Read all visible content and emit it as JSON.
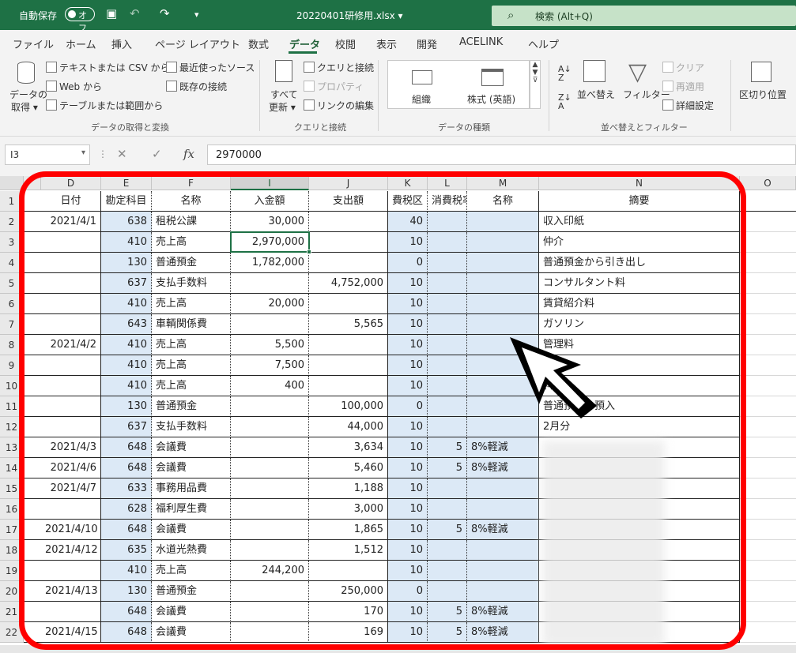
{
  "titlebar": {
    "autosave_label": "自動保存",
    "autosave_state": "オフ",
    "doc_title": "20220401研修用.xlsx",
    "search_placeholder": "検索 (Alt+Q)"
  },
  "menu": [
    "ファイル",
    "ホーム",
    "挿入",
    "ページ レイアウト",
    "数式",
    "データ",
    "校閲",
    "表示",
    "開発",
    "ACELINK",
    "ヘルプ"
  ],
  "menu_active": "データ",
  "ribbon": {
    "get_data": [
      "データの",
      "取得"
    ],
    "text_csv": "テキストまたは CSV から",
    "from_web": "Web から",
    "from_table": "テーブルまたは範囲から",
    "recent_sources": "最近使ったソース",
    "existing_conn": "既存の接続",
    "group_get": "データの取得と変換",
    "refresh_all": [
      "すべて",
      "更新"
    ],
    "queries_conn": "クエリと接続",
    "properties": "プロパティ",
    "edit_links": "リンクの編集",
    "group_queries": "クエリと接続",
    "type_org": "組織",
    "type_stock": "株式 (英語)",
    "group_types": "データの種類",
    "sort": "並べ替え",
    "filter": "フィルター",
    "clear": "クリア",
    "reapply": "再適用",
    "advanced": "詳細設定",
    "group_sort": "並べ替えとフィルター",
    "text_to_columns": "区切り位置"
  },
  "formula_bar": {
    "name_box": "I3",
    "value": "2970000"
  },
  "columns": [
    "D",
    "E",
    "F",
    "I",
    "J",
    "K",
    "L",
    "M",
    "N",
    "O"
  ],
  "selected_column": "I",
  "header_row": [
    "日付",
    "勘定科目",
    "名称",
    "入金額",
    "支出額",
    "費税区",
    "消費税率",
    "名称",
    "摘要"
  ],
  "rows": [
    {
      "n": "2",
      "date": "2021/4/1",
      "code": "638",
      "name": "租税公課",
      "in": "30,000",
      "out": "",
      "tax": "40",
      "rate": "",
      "name2": "",
      "memo": "収入印紙"
    },
    {
      "n": "3",
      "date": "",
      "code": "410",
      "name": "売上高",
      "in": "2,970,000",
      "out": "",
      "tax": "10",
      "rate": "",
      "name2": "",
      "memo": "仲介"
    },
    {
      "n": "4",
      "date": "",
      "code": "130",
      "name": "普通預金",
      "in": "1,782,000",
      "out": "",
      "tax": "0",
      "rate": "",
      "name2": "",
      "memo": "普通預金から引き出し"
    },
    {
      "n": "5",
      "date": "",
      "code": "637",
      "name": "支払手数料",
      "in": "",
      "out": "4,752,000",
      "tax": "10",
      "rate": "",
      "name2": "",
      "memo": "コンサルタント料"
    },
    {
      "n": "6",
      "date": "",
      "code": "410",
      "name": "売上高",
      "in": "20,000",
      "out": "",
      "tax": "10",
      "rate": "",
      "name2": "",
      "memo": "賃貸紹介料"
    },
    {
      "n": "7",
      "date": "",
      "code": "643",
      "name": "車輌関係費",
      "in": "",
      "out": "5,565",
      "tax": "10",
      "rate": "",
      "name2": "",
      "memo": "ガソリン"
    },
    {
      "n": "8",
      "date": "2021/4/2",
      "code": "410",
      "name": "売上高",
      "in": "5,500",
      "out": "",
      "tax": "10",
      "rate": "",
      "name2": "",
      "memo": "管理料"
    },
    {
      "n": "9",
      "date": "",
      "code": "410",
      "name": "売上高",
      "in": "7,500",
      "out": "",
      "tax": "10",
      "rate": "",
      "name2": "",
      "memo": "料"
    },
    {
      "n": "10",
      "date": "",
      "code": "410",
      "name": "売上高",
      "in": "400",
      "out": "",
      "tax": "10",
      "rate": "",
      "name2": "",
      "memo": "料"
    },
    {
      "n": "11",
      "date": "",
      "code": "130",
      "name": "普通預金",
      "in": "",
      "out": "100,000",
      "tax": "0",
      "rate": "",
      "name2": "",
      "memo": "普通預金へ預入"
    },
    {
      "n": "12",
      "date": "",
      "code": "637",
      "name": "支払手数料",
      "in": "",
      "out": "44,000",
      "tax": "10",
      "rate": "",
      "name2": "",
      "memo": "2月分"
    },
    {
      "n": "13",
      "date": "2021/4/3",
      "code": "648",
      "name": "会議費",
      "in": "",
      "out": "3,634",
      "tax": "10",
      "rate": "5",
      "name2": "8%軽減",
      "memo": ""
    },
    {
      "n": "14",
      "date": "2021/4/6",
      "code": "648",
      "name": "会議費",
      "in": "",
      "out": "5,460",
      "tax": "10",
      "rate": "5",
      "name2": "8%軽減",
      "memo": ""
    },
    {
      "n": "15",
      "date": "2021/4/7",
      "code": "633",
      "name": "事務用品費",
      "in": "",
      "out": "1,188",
      "tax": "10",
      "rate": "",
      "name2": "",
      "memo": ""
    },
    {
      "n": "16",
      "date": "",
      "code": "628",
      "name": "福利厚生費",
      "in": "",
      "out": "3,000",
      "tax": "10",
      "rate": "",
      "name2": "",
      "memo": ""
    },
    {
      "n": "17",
      "date": "2021/4/10",
      "code": "648",
      "name": "会議費",
      "in": "",
      "out": "1,865",
      "tax": "10",
      "rate": "5",
      "name2": "8%軽減",
      "memo": ""
    },
    {
      "n": "18",
      "date": "2021/4/12",
      "code": "635",
      "name": "水道光熱費",
      "in": "",
      "out": "1,512",
      "tax": "10",
      "rate": "",
      "name2": "",
      "memo": ""
    },
    {
      "n": "19",
      "date": "",
      "code": "410",
      "name": "売上高",
      "in": "244,200",
      "out": "",
      "tax": "10",
      "rate": "",
      "name2": "",
      "memo": ""
    },
    {
      "n": "20",
      "date": "2021/4/13",
      "code": "130",
      "name": "普通預金",
      "in": "",
      "out": "250,000",
      "tax": "0",
      "rate": "",
      "name2": "",
      "memo": ""
    },
    {
      "n": "21",
      "date": "",
      "code": "648",
      "name": "会議費",
      "in": "",
      "out": "170",
      "tax": "10",
      "rate": "5",
      "name2": "8%軽減",
      "memo": ""
    },
    {
      "n": "22",
      "date": "2021/4/15",
      "code": "648",
      "name": "会議費",
      "in": "",
      "out": "169",
      "tax": "10",
      "rate": "5",
      "name2": "8%軽減",
      "memo": ""
    }
  ],
  "colors": {
    "excel_green": "#1e7145",
    "highlight_blue": "#dce9f6",
    "annotation_red": "#ff0000"
  }
}
